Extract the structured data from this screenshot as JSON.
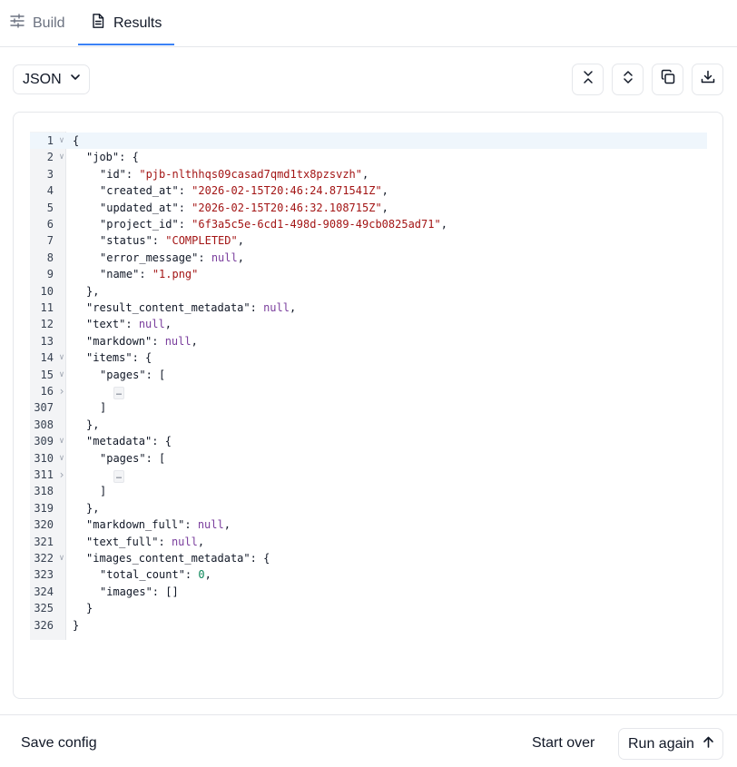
{
  "tabs": [
    {
      "label": "Build",
      "icon": "sliders-icon",
      "active": false
    },
    {
      "label": "Results",
      "icon": "document-icon",
      "active": true
    }
  ],
  "toolbar": {
    "format_label": "JSON",
    "buttons": [
      "collapse-all-icon",
      "expand-all-icon",
      "copy-icon",
      "download-icon"
    ]
  },
  "editor": {
    "active_line": 1,
    "lines": [
      {
        "n": "1",
        "fold": "open",
        "indent": 0,
        "tokens": [
          {
            "t": "{",
            "c": "k"
          }
        ]
      },
      {
        "n": "2",
        "fold": "open",
        "indent": 1,
        "tokens": [
          {
            "t": "\"job\"",
            "c": "k"
          },
          {
            "t": ": {",
            "c": "k"
          }
        ]
      },
      {
        "n": "3",
        "fold": "",
        "indent": 2,
        "tokens": [
          {
            "t": "\"id\"",
            "c": "k"
          },
          {
            "t": ": ",
            "c": "k"
          },
          {
            "t": "\"pjb-nlthhqs09casad7qmd1tx8pzsvzh\"",
            "c": "s"
          },
          {
            "t": ",",
            "c": "k"
          }
        ]
      },
      {
        "n": "4",
        "fold": "",
        "indent": 2,
        "tokens": [
          {
            "t": "\"created_at\"",
            "c": "k"
          },
          {
            "t": ": ",
            "c": "k"
          },
          {
            "t": "\"2026-02-15T20:46:24.871541Z\"",
            "c": "s"
          },
          {
            "t": ",",
            "c": "k"
          }
        ]
      },
      {
        "n": "5",
        "fold": "",
        "indent": 2,
        "tokens": [
          {
            "t": "\"updated_at\"",
            "c": "k"
          },
          {
            "t": ": ",
            "c": "k"
          },
          {
            "t": "\"2026-02-15T20:46:32.108715Z\"",
            "c": "s"
          },
          {
            "t": ",",
            "c": "k"
          }
        ]
      },
      {
        "n": "6",
        "fold": "",
        "indent": 2,
        "tokens": [
          {
            "t": "\"project_id\"",
            "c": "k"
          },
          {
            "t": ": ",
            "c": "k"
          },
          {
            "t": "\"6f3a5c5e-6cd1-498d-9089-49cb0825ad71\"",
            "c": "s"
          },
          {
            "t": ",",
            "c": "k"
          }
        ]
      },
      {
        "n": "7",
        "fold": "",
        "indent": 2,
        "tokens": [
          {
            "t": "\"status\"",
            "c": "k"
          },
          {
            "t": ": ",
            "c": "k"
          },
          {
            "t": "\"COMPLETED\"",
            "c": "s"
          },
          {
            "t": ",",
            "c": "k"
          }
        ]
      },
      {
        "n": "8",
        "fold": "",
        "indent": 2,
        "tokens": [
          {
            "t": "\"error_message\"",
            "c": "k"
          },
          {
            "t": ": ",
            "c": "k"
          },
          {
            "t": "null",
            "c": "n"
          },
          {
            "t": ",",
            "c": "k"
          }
        ]
      },
      {
        "n": "9",
        "fold": "",
        "indent": 2,
        "tokens": [
          {
            "t": "\"name\"",
            "c": "k"
          },
          {
            "t": ": ",
            "c": "k"
          },
          {
            "t": "\"1.png\"",
            "c": "s"
          }
        ]
      },
      {
        "n": "10",
        "fold": "",
        "indent": 1,
        "tokens": [
          {
            "t": "},",
            "c": "k"
          }
        ]
      },
      {
        "n": "11",
        "fold": "",
        "indent": 1,
        "tokens": [
          {
            "t": "\"result_content_metadata\"",
            "c": "k"
          },
          {
            "t": ": ",
            "c": "k"
          },
          {
            "t": "null",
            "c": "n"
          },
          {
            "t": ",",
            "c": "k"
          }
        ]
      },
      {
        "n": "12",
        "fold": "",
        "indent": 1,
        "tokens": [
          {
            "t": "\"text\"",
            "c": "k"
          },
          {
            "t": ": ",
            "c": "k"
          },
          {
            "t": "null",
            "c": "n"
          },
          {
            "t": ",",
            "c": "k"
          }
        ]
      },
      {
        "n": "13",
        "fold": "",
        "indent": 1,
        "tokens": [
          {
            "t": "\"markdown\"",
            "c": "k"
          },
          {
            "t": ": ",
            "c": "k"
          },
          {
            "t": "null",
            "c": "n"
          },
          {
            "t": ",",
            "c": "k"
          }
        ]
      },
      {
        "n": "14",
        "fold": "open",
        "indent": 1,
        "tokens": [
          {
            "t": "\"items\"",
            "c": "k"
          },
          {
            "t": ": {",
            "c": "k"
          }
        ]
      },
      {
        "n": "15",
        "fold": "open",
        "indent": 2,
        "tokens": [
          {
            "t": "\"pages\"",
            "c": "k"
          },
          {
            "t": ": [",
            "c": "k"
          }
        ]
      },
      {
        "n": "16",
        "fold": "closed",
        "indent": 3,
        "tokens": [
          {
            "t": "…",
            "c": "ell"
          }
        ]
      },
      {
        "n": "307",
        "fold": "",
        "indent": 2,
        "tokens": [
          {
            "t": "]",
            "c": "k"
          }
        ]
      },
      {
        "n": "308",
        "fold": "",
        "indent": 1,
        "tokens": [
          {
            "t": "},",
            "c": "k"
          }
        ]
      },
      {
        "n": "309",
        "fold": "open",
        "indent": 1,
        "tokens": [
          {
            "t": "\"metadata\"",
            "c": "k"
          },
          {
            "t": ": {",
            "c": "k"
          }
        ]
      },
      {
        "n": "310",
        "fold": "open",
        "indent": 2,
        "tokens": [
          {
            "t": "\"pages\"",
            "c": "k"
          },
          {
            "t": ": [",
            "c": "k"
          }
        ]
      },
      {
        "n": "311",
        "fold": "closed",
        "indent": 3,
        "tokens": [
          {
            "t": "…",
            "c": "ell"
          }
        ]
      },
      {
        "n": "318",
        "fold": "",
        "indent": 2,
        "tokens": [
          {
            "t": "]",
            "c": "k"
          }
        ]
      },
      {
        "n": "319",
        "fold": "",
        "indent": 1,
        "tokens": [
          {
            "t": "},",
            "c": "k"
          }
        ]
      },
      {
        "n": "320",
        "fold": "",
        "indent": 1,
        "tokens": [
          {
            "t": "\"markdown_full\"",
            "c": "k"
          },
          {
            "t": ": ",
            "c": "k"
          },
          {
            "t": "null",
            "c": "n"
          },
          {
            "t": ",",
            "c": "k"
          }
        ]
      },
      {
        "n": "321",
        "fold": "",
        "indent": 1,
        "tokens": [
          {
            "t": "\"text_full\"",
            "c": "k"
          },
          {
            "t": ": ",
            "c": "k"
          },
          {
            "t": "null",
            "c": "n"
          },
          {
            "t": ",",
            "c": "k"
          }
        ]
      },
      {
        "n": "322",
        "fold": "open",
        "indent": 1,
        "tokens": [
          {
            "t": "\"images_content_metadata\"",
            "c": "k"
          },
          {
            "t": ": {",
            "c": "k"
          }
        ]
      },
      {
        "n": "323",
        "fold": "",
        "indent": 2,
        "tokens": [
          {
            "t": "\"total_count\"",
            "c": "k"
          },
          {
            "t": ": ",
            "c": "k"
          },
          {
            "t": "0",
            "c": "num"
          },
          {
            "t": ",",
            "c": "k"
          }
        ]
      },
      {
        "n": "324",
        "fold": "",
        "indent": 2,
        "tokens": [
          {
            "t": "\"images\"",
            "c": "k"
          },
          {
            "t": ": []",
            "c": "k"
          }
        ]
      },
      {
        "n": "325",
        "fold": "",
        "indent": 1,
        "tokens": [
          {
            "t": "}",
            "c": "k"
          }
        ]
      },
      {
        "n": "326",
        "fold": "",
        "indent": 0,
        "tokens": [
          {
            "t": "}",
            "c": "k"
          }
        ]
      }
    ]
  },
  "footer": {
    "save_config_label": "Save config",
    "start_over_label": "Start over",
    "run_again_label": "Run again"
  },
  "colors": {
    "accent": "#3b82f6",
    "string": "#a31515",
    "null": "#7a3e9d",
    "number": "#098658"
  }
}
